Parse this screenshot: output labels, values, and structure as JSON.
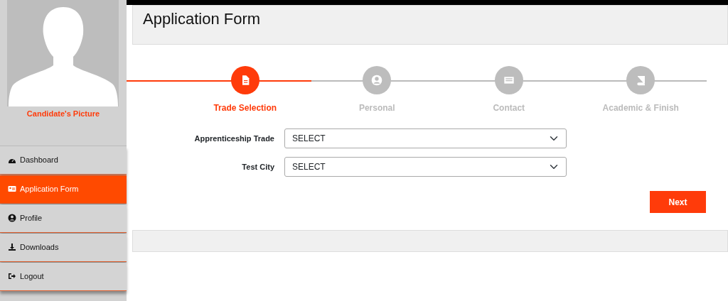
{
  "sidebar": {
    "picture_label": "Candidate's Picture",
    "items": [
      {
        "label": "Dashboard",
        "selected": false
      },
      {
        "label": "Application Form",
        "selected": true
      },
      {
        "label": "Profile",
        "selected": false
      },
      {
        "label": "Downloads",
        "selected": false
      },
      {
        "label": "Logout",
        "selected": false
      }
    ]
  },
  "page_title": "Application Form",
  "steps": [
    {
      "label": "Trade Selection",
      "selected": true
    },
    {
      "label": "Personal",
      "selected": false
    },
    {
      "label": "Contact",
      "selected": false
    },
    {
      "label": "Academic & Finish",
      "selected": false
    }
  ],
  "fields": [
    {
      "label": "Apprenticeship Trade",
      "value": "SELECT"
    },
    {
      "label": "Test City",
      "value": "SELECT"
    }
  ],
  "next_button": "Next"
}
